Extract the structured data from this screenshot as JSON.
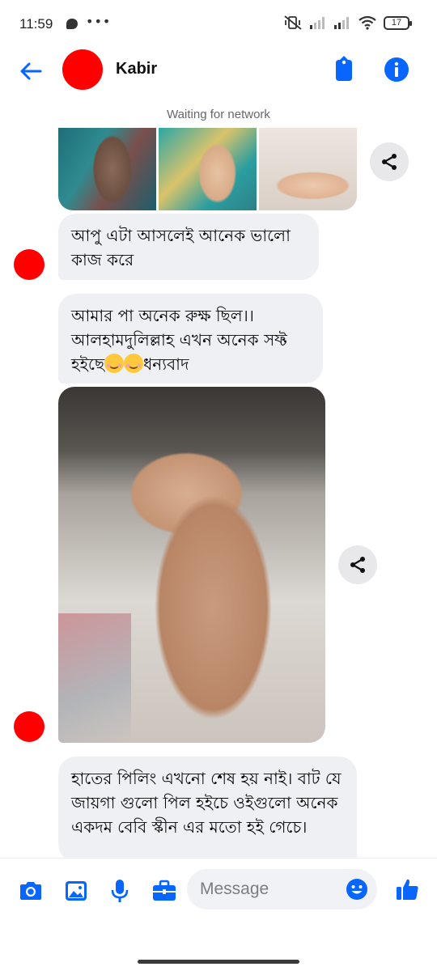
{
  "status_bar": {
    "time": "11:59",
    "dots": "•••",
    "battery": "17"
  },
  "header": {
    "contact_name": "Kabir"
  },
  "banner": {
    "network_status": "Waiting for network"
  },
  "messages": [
    {
      "id": "m1",
      "type": "text",
      "text": "আপু এটা আসলেই আনেক ভালো কাজ করে"
    },
    {
      "id": "m2",
      "type": "text",
      "text_before": "আমার পা অনেক রুক্ষ ছিল।। আলহামদুলিল্লাহ এখন অনেক সফ্ট হইছে",
      "text_after": "ধন্যবাদ"
    },
    {
      "id": "m3",
      "type": "text",
      "text": "হাতের পিলিং এখনো শেষ হয় নাই। বাট যে জায়গা গুলো পিল হইচে ওইগুলো অনেক একদম বেবি স্কীন এর মতো হই গেচে।"
    }
  ],
  "composer": {
    "placeholder": "Message"
  },
  "colors": {
    "accent": "#0866ff",
    "avatar": "#ff0000",
    "bubble": "#eff0f3"
  }
}
